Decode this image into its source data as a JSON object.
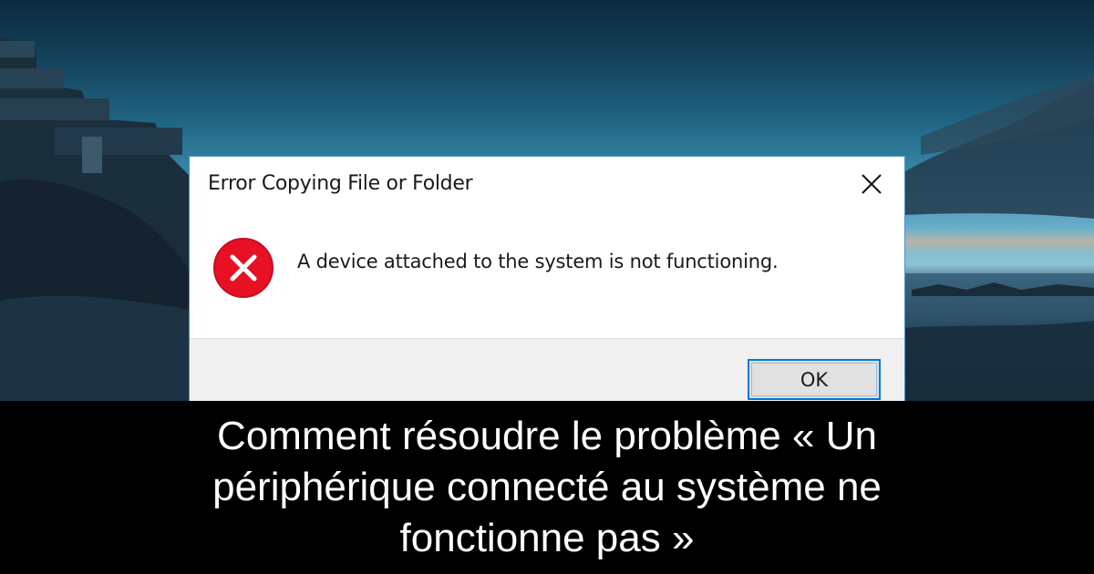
{
  "dialog": {
    "title": "Error Copying File or Folder",
    "message": "A device attached to the system is not functioning.",
    "ok_label": "OK",
    "icon": "error-x-circle-icon",
    "close_icon": "close-icon"
  },
  "caption": {
    "text": "Comment résoudre le problème « Un périphérique connecté au système ne fonctionne pas »"
  },
  "colors": {
    "error_red": "#e81123",
    "accent_blue": "#0078d7",
    "caption_bg": "#000000"
  }
}
